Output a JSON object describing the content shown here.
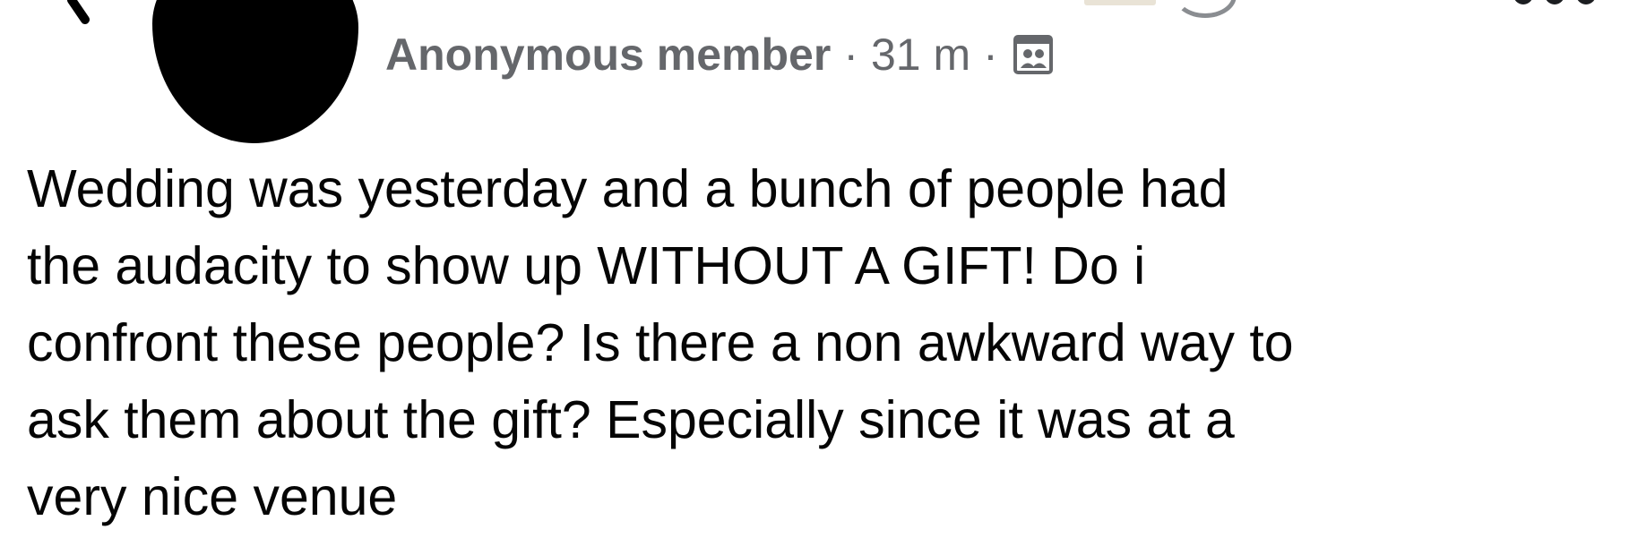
{
  "post": {
    "author": "Anonymous member",
    "separator": "·",
    "timestamp": "31 m",
    "audience_icon": "group-audience-icon",
    "text_lines": [
      "Wedding was yesterday and a bunch of people had",
      "the audacity to show up WITHOUT A GIFT!  Do i",
      "confront these people? Is there a non awkward way to",
      "ask them about the gift? Especially since it was at a",
      "very nice venue"
    ]
  },
  "icons": {
    "back": "chevron-left-icon",
    "more": "more-options-icon"
  },
  "colors": {
    "meta_text": "#65676b",
    "body_text": "#050505",
    "avatar": "#000000"
  }
}
